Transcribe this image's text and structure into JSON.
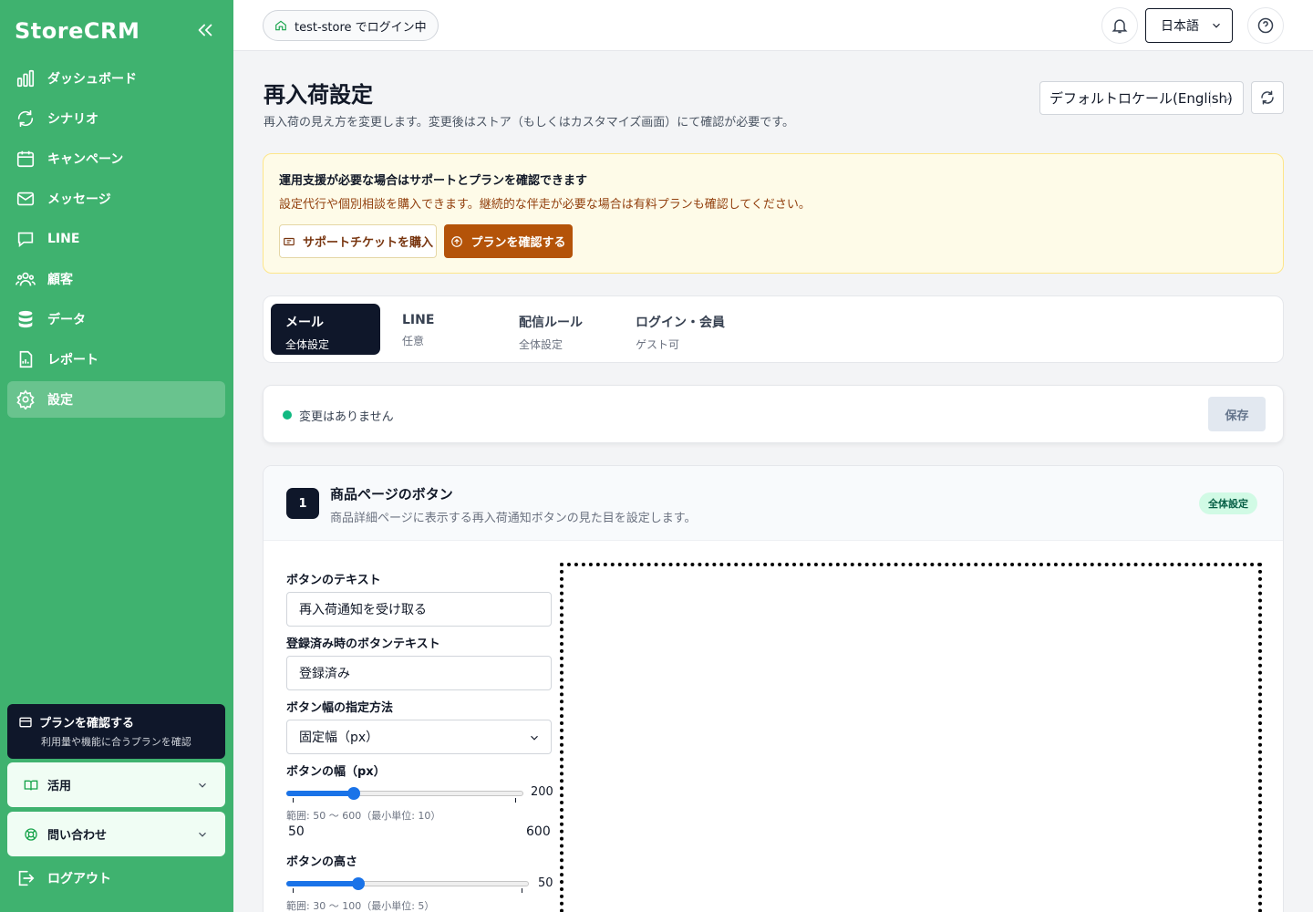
{
  "sidebar": {
    "brand": "StoreCRM",
    "items": [
      {
        "label": "ダッシュボード",
        "icon": "chart-bar-icon"
      },
      {
        "label": "シナリオ",
        "icon": "refresh-icon"
      },
      {
        "label": "キャンペーン",
        "icon": "calendar-icon"
      },
      {
        "label": "メッセージ",
        "icon": "mail-icon"
      },
      {
        "label": "LINE",
        "icon": "chat-bubble-icon"
      },
      {
        "label": "顧客",
        "icon": "users-icon"
      },
      {
        "label": "データ",
        "icon": "database-icon"
      },
      {
        "label": "レポート",
        "icon": "report-icon"
      },
      {
        "label": "設定",
        "icon": "gear-icon",
        "active": true
      }
    ],
    "plan_card": {
      "title": "プランを確認する",
      "subtitle": "利用量や機能に合うプランを確認"
    },
    "accordion_usage": "活用",
    "accordion_contact": "問い合わせ",
    "logout": "ログアウト"
  },
  "topbar": {
    "store_label": "test-store でログイン中",
    "language": "日本語"
  },
  "page": {
    "title": "再入荷設定",
    "subtitle": "再入荷の見え方を変更します。変更後はストア（もしくはカスタマイズ画面）にて確認が必要です。",
    "locale_select": "デフォルトロケール(English)"
  },
  "notice": {
    "heading": "運用支援が必要な場合はサポートとプランを確認できます",
    "description": "設定代行や個別相談を購入できます。継続的な伴走が必要な場合は有料プランも確認してください。",
    "ticket_button": "サポートチケットを購入",
    "plan_button": "プランを確認する"
  },
  "tabs": [
    {
      "label": "メール",
      "sub": "全体設定",
      "active": true
    },
    {
      "label": "LINE",
      "sub": "任意"
    },
    {
      "label": "配信ルール",
      "sub": "全体設定"
    },
    {
      "label": "ログイン・会員",
      "sub": "ゲスト可"
    }
  ],
  "status": {
    "text": "変更はありません",
    "save_label": "保存"
  },
  "section": {
    "number": "1",
    "title": "商品ページのボタン",
    "description": "商品詳細ページに表示する再入荷通知ボタンの見た目を設定します。",
    "badge": "全体設定",
    "fields": {
      "button_text_label": "ボタンのテキスト",
      "button_text_value": "再入荷通知を受け取る",
      "registered_text_label": "登録済み時のボタンテキスト",
      "registered_text_value": "登録済み",
      "width_mode_label": "ボタン幅の指定方法",
      "width_mode_value": "固定幅（px）",
      "width_label": "ボタンの幅（px）",
      "width_value": 200,
      "width_min": 50,
      "width_max": 600,
      "width_range_text": "範囲: 50 〜 600（最小単位: 10）",
      "height_label": "ボタンの高さ",
      "height_value": 50,
      "height_min": 30,
      "height_max": 100,
      "height_range_text": "範囲: 30 〜 100（最小単位: 5）"
    }
  },
  "colors": {
    "sidebar": "#3fb26f",
    "accent_dark": "#0f172a",
    "warning_button": "#b45309",
    "slider": "#1a73e8"
  }
}
